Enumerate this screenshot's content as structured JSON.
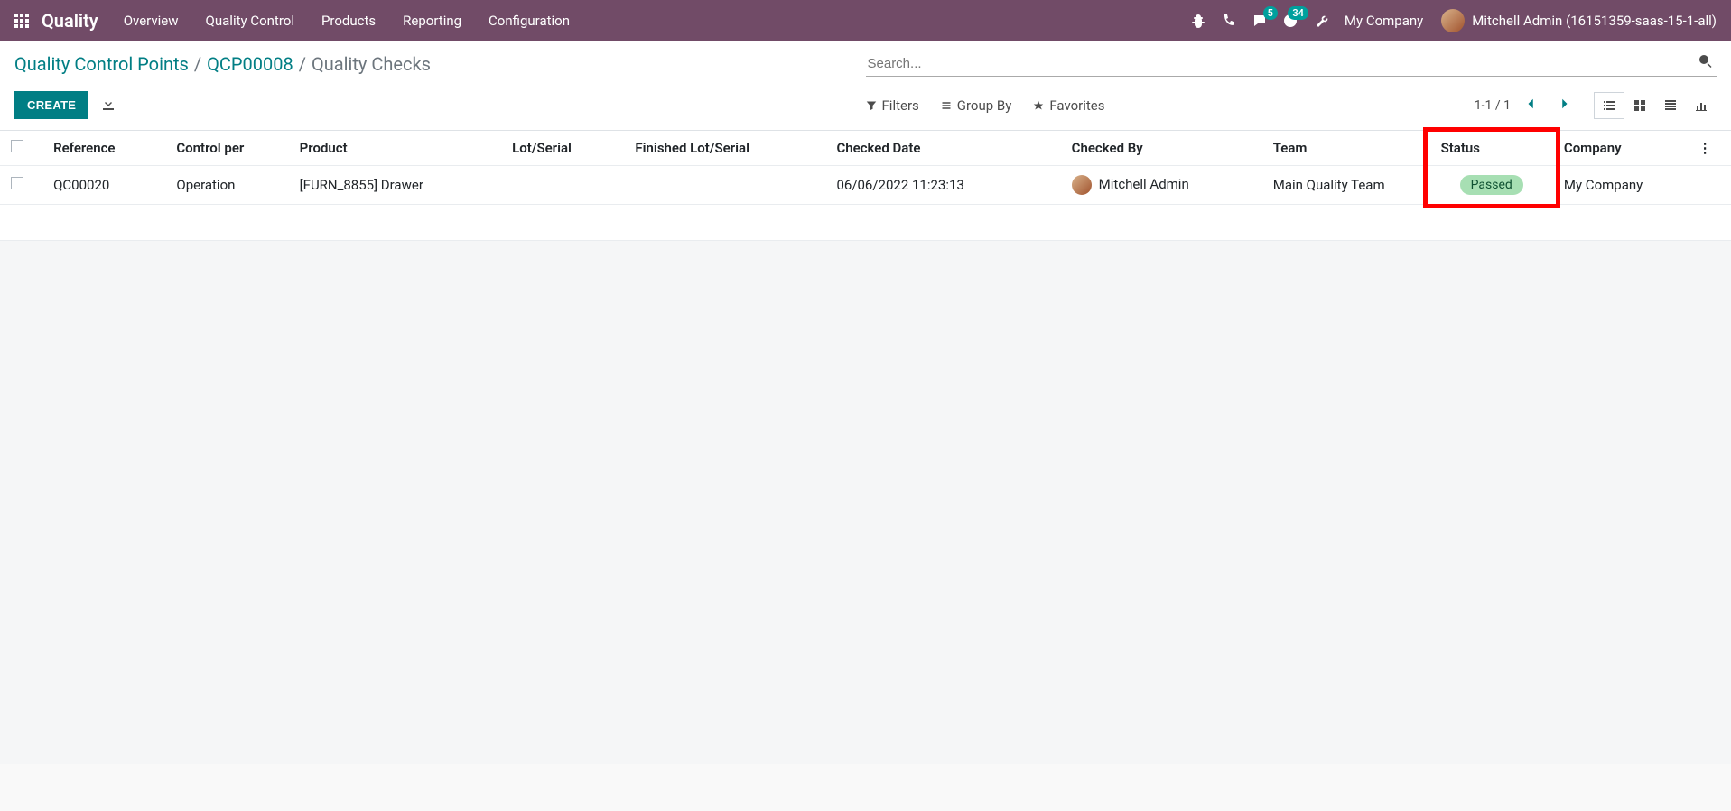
{
  "navbar": {
    "brand": "Quality",
    "menu": [
      "Overview",
      "Quality Control",
      "Products",
      "Reporting",
      "Configuration"
    ],
    "messaging_badge": "5",
    "activity_badge": "34",
    "company": "My Company",
    "user": "Mitchell Admin (16151359-saas-15-1-all)"
  },
  "breadcrumb": {
    "crumb1": "Quality Control Points",
    "crumb2": "QCP00008",
    "active": "Quality Checks"
  },
  "search": {
    "placeholder": "Search..."
  },
  "buttons": {
    "create": "CREATE"
  },
  "filters": {
    "filters": "Filters",
    "groupby": "Group By",
    "favorites": "Favorites"
  },
  "pager": {
    "range": "1-1 / 1"
  },
  "table": {
    "headers": {
      "reference": "Reference",
      "control_per": "Control per",
      "product": "Product",
      "lot": "Lot/Serial",
      "finished_lot": "Finished Lot/Serial",
      "checked_date": "Checked Date",
      "checked_by": "Checked By",
      "team": "Team",
      "status": "Status",
      "company": "Company"
    },
    "rows": [
      {
        "reference": "QC00020",
        "control_per": "Operation",
        "product": "[FURN_8855] Drawer",
        "lot": "",
        "finished_lot": "",
        "checked_date": "06/06/2022 11:23:13",
        "checked_by": "Mitchell Admin",
        "team": "Main Quality Team",
        "status": "Passed",
        "company": "My Company"
      }
    ]
  }
}
